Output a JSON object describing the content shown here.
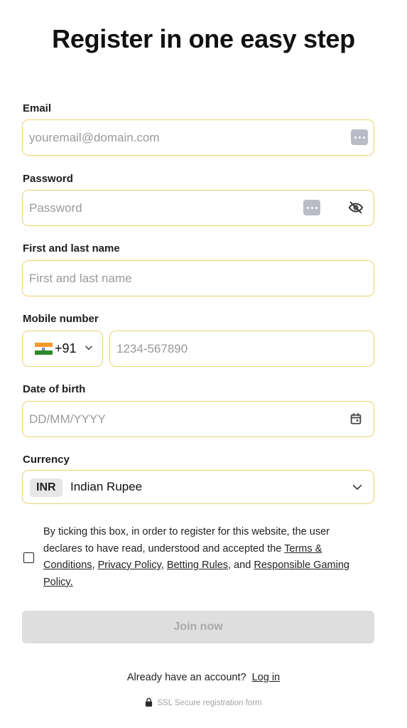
{
  "page": {
    "title": "Register in one easy step"
  },
  "form": {
    "email": {
      "label": "Email",
      "placeholder": "youremail@domain.com",
      "value": ""
    },
    "password": {
      "label": "Password",
      "placeholder": "Password",
      "value": ""
    },
    "name": {
      "label": "First and last name",
      "placeholder": "First and last name",
      "value": ""
    },
    "mobile": {
      "label": "Mobile number",
      "country_code": "+91",
      "placeholder": "1234-567890",
      "value": ""
    },
    "dob": {
      "label": "Date of birth",
      "placeholder": "DD/MM/YYYY",
      "value": ""
    },
    "currency": {
      "label": "Currency",
      "code": "INR",
      "name": "Indian Rupee"
    }
  },
  "terms": {
    "checked": false,
    "text_before": "By ticking this box, in order to register for this website, the user declares to have read, understood and accepted the ",
    "link_terms": "Terms & Conditions,",
    "link_privacy": "Privacy Policy,",
    "link_betting": "Betting Rules,",
    "text_and": " and ",
    "link_responsible": "Responsible Gaming Policy."
  },
  "actions": {
    "join_label": "Join now"
  },
  "footer": {
    "login_prompt": "Already have an account?",
    "login_link": "Log in",
    "ssl_text": "SSL Secure registration form"
  },
  "colors": {
    "field_border": "#ecd36f",
    "button_disabled_bg": "#dedede",
    "button_disabled_text": "#a9a9a9",
    "flag_saffron": "#f39a2e",
    "flag_white": "#ffffff",
    "flag_green": "#2c8a2c"
  },
  "icons": {
    "autofill": "autofill-dots-icon",
    "password_toggle": "eye-off-icon",
    "calendar": "calendar-icon",
    "dropdown": "chevron-down-icon",
    "flag": "india-flag-icon",
    "lock": "lock-icon"
  }
}
